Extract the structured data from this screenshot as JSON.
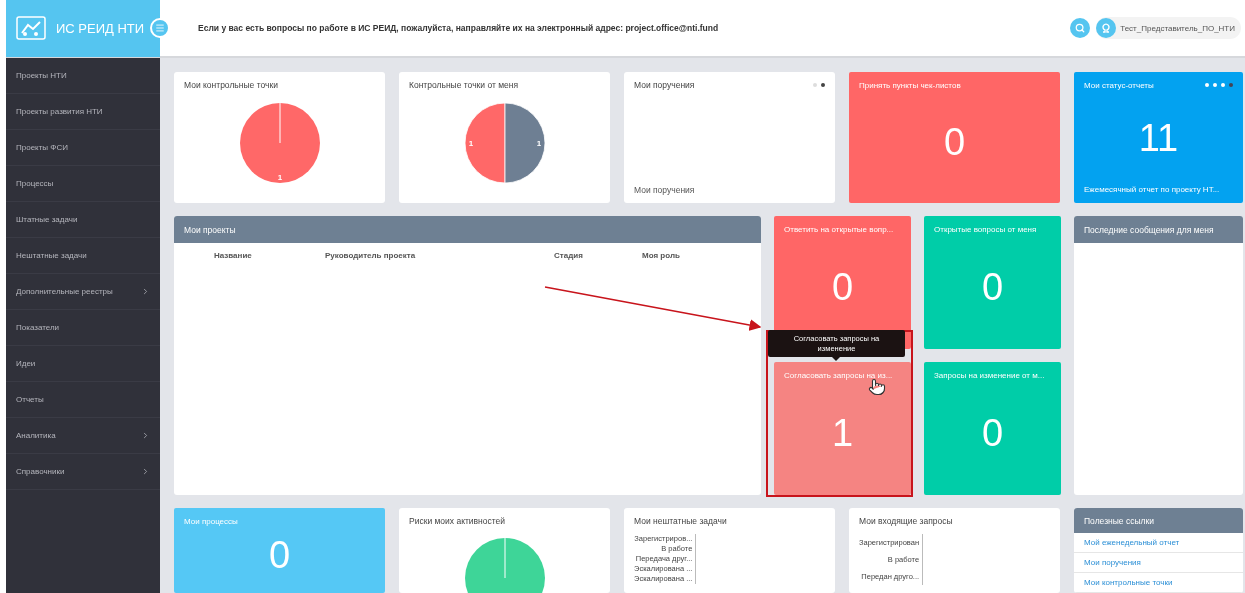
{
  "header": {
    "app_title": "ИС РЕИД НТИ",
    "notice": "Если у вас есть вопросы по работе в ИС РЕИД, пожалуйста, направляйте их на электронный адрес: project.office@nti.fund",
    "user": "Тест_Представитель_ПО_НТИ"
  },
  "sidebar": {
    "items": [
      {
        "label": "Проекты НТИ",
        "has_submenu": false
      },
      {
        "label": "Проекты развития НТИ",
        "has_submenu": false
      },
      {
        "label": "Проекты ФСИ",
        "has_submenu": false
      },
      {
        "label": "Процессы",
        "has_submenu": false
      },
      {
        "label": "Штатные задачи",
        "has_submenu": false
      },
      {
        "label": "Нештатные задачи",
        "has_submenu": false
      },
      {
        "label": "Дополнительные реестры",
        "has_submenu": true
      },
      {
        "label": "Показатели",
        "has_submenu": false
      },
      {
        "label": "Идеи",
        "has_submenu": false
      },
      {
        "label": "Отчеты",
        "has_submenu": false
      },
      {
        "label": "Аналитика",
        "has_submenu": true
      },
      {
        "label": "Справочники",
        "has_submenu": true
      }
    ]
  },
  "row_1": [
    {
      "kind": "pie",
      "title": "Мои контрольные точки",
      "chart_data": {
        "type": "pie",
        "values": [
          1
        ],
        "data_labels": true
      }
    },
    {
      "kind": "pie",
      "title": "Контрольные точки от меня",
      "chart_data": {
        "type": "pie",
        "values": [
          1,
          1
        ],
        "data_labels": true
      }
    },
    {
      "kind": "list",
      "title": "Мои поручения",
      "footer": "Мои поручения",
      "pager": [
        {
          "selected": false
        },
        {
          "selected": true
        }
      ]
    },
    {
      "kind": "counter",
      "title": "Принять пункты чек-листов",
      "value": "0",
      "color": "#ff6666"
    },
    {
      "kind": "counter",
      "title": "Мои статус-отчеты",
      "value": "11",
      "color": "#03a2f0",
      "footer": "Ежемесячный отчет по проекту НТ...",
      "pager": [
        {
          "selected": false
        },
        {
          "selected": false
        },
        {
          "selected": false
        },
        {
          "selected": true
        }
      ]
    }
  ],
  "projects": {
    "title": "Мои проекты",
    "columns": [
      "Название",
      "Руководитель проекта",
      "Стадия",
      "Моя роль"
    ]
  },
  "tiles": [
    {
      "title": "Ответить на открытые вопр...",
      "value": "0",
      "color": "#ff6666",
      "hovered": false,
      "highlighted": false
    },
    {
      "title": "Открытые вопросы от меня",
      "value": "0",
      "color": "#00cda8",
      "hovered": false,
      "highlighted": false
    },
    {
      "title": "Согласовать запросы на из...",
      "value": "1",
      "color": "#f58482",
      "hovered": true,
      "highlighted": true,
      "tooltip": "Согласовать запросы на изменение"
    },
    {
      "title": "Запросы на изменение от м...",
      "value": "0",
      "color": "#00cda8",
      "hovered": false,
      "highlighted": false
    }
  ],
  "messages_panel": {
    "title": "Последние сообщения для меня"
  },
  "row_3": [
    {
      "kind": "counter",
      "title": "Мои процессы",
      "value": "0",
      "color": "#55c8f5"
    },
    {
      "kind": "pie_drawing",
      "title": "Риски моих активностей"
    },
    {
      "kind": "bars",
      "title": "Мои нештатные задачи",
      "axis_labels": [
        "Зарегистриров...",
        "В работе",
        "Передача друг...",
        "Эскалирована ...",
        "Эскалирована ..."
      ]
    },
    {
      "kind": "bars",
      "title": "Мои входящие запросы",
      "axis_labels": [
        "Зарегистрирован",
        "В работе",
        "Передан друго..."
      ]
    },
    {
      "kind": "links",
      "title": "Полезные ссылки",
      "links": [
        "Мой еженедельный отчет",
        "Мои поручения",
        "Мои контрольные точки"
      ]
    }
  ]
}
